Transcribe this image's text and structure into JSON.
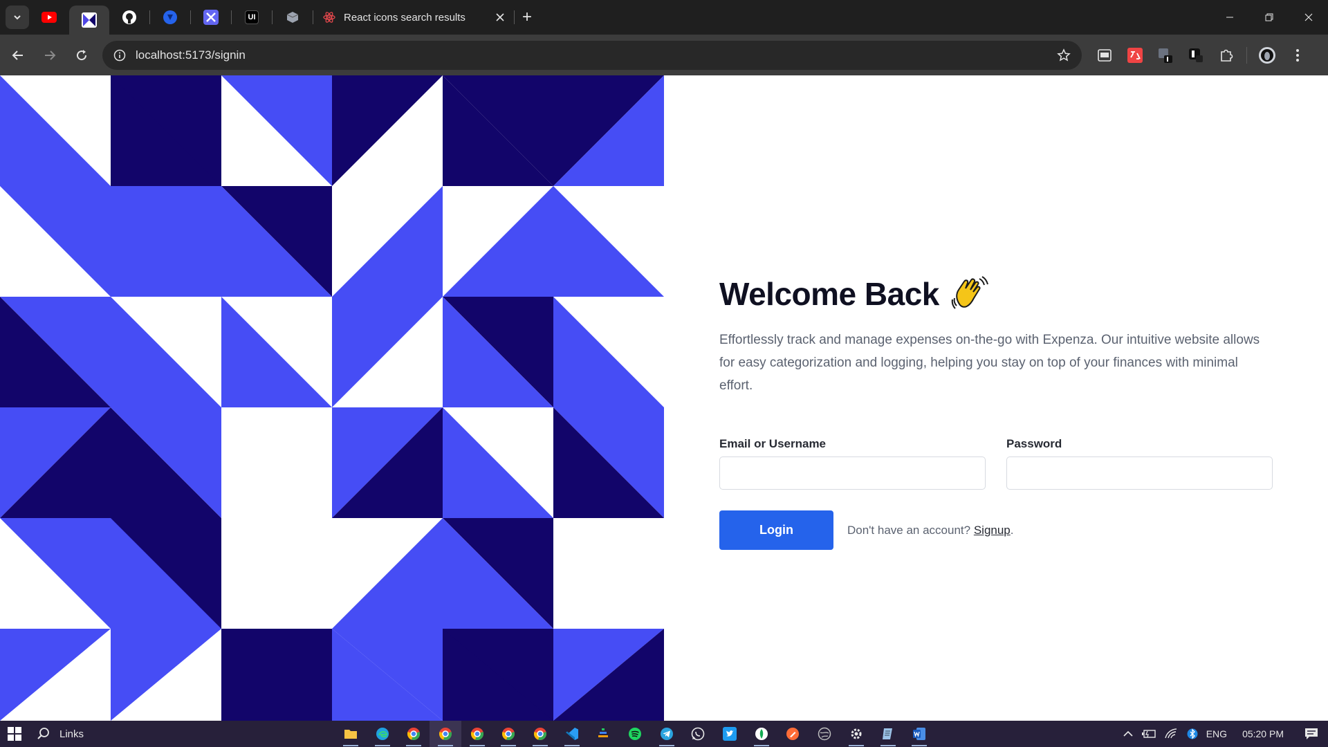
{
  "browser": {
    "active_tab_title": "React icons search results",
    "url": "localhost:5173/signin",
    "new_tab_symbol": "+"
  },
  "pinned_tabs": [
    {
      "name": "youtube",
      "color": "#ff0000"
    },
    {
      "name": "app-active",
      "color": "#4f46e5"
    },
    {
      "name": "github",
      "color": "#ffffff"
    },
    {
      "name": "blue-app",
      "color": "#2563eb"
    },
    {
      "name": "tools",
      "color": "#4f46e5"
    },
    {
      "name": "ui",
      "color": "#000000",
      "label": "UI"
    },
    {
      "name": "cube",
      "color": "#9ca3af"
    }
  ],
  "page": {
    "heading": "Welcome Back",
    "description": "Effortlessly track and manage expenses on-the-go with Expenza. Our intuitive website allows for easy categorization and logging, helping you stay on top of your finances with minimal effort.",
    "email_label": "Email or Username",
    "password_label": "Password",
    "login_label": "Login",
    "no_account_text": "Don't have an account?",
    "signup_link": "Signup",
    "signup_suffix": "."
  },
  "colors": {
    "pattern_blue": "#464df5",
    "pattern_navy": "#12056a",
    "button_blue": "#2563eb",
    "heading": "#0f1021"
  },
  "taskbar": {
    "search_label": "Links",
    "language": "ENG",
    "time": "05:20 PM",
    "apps": [
      "file-explorer",
      "edge",
      "chrome-1",
      "chrome-2",
      "chrome-3",
      "chrome-4",
      "chrome-5",
      "vscode",
      "app-stack",
      "spotify",
      "telegram",
      "whatsapp",
      "twitter",
      "mongodb",
      "postman",
      "app-circle",
      "settings",
      "notepad",
      "word"
    ]
  }
}
